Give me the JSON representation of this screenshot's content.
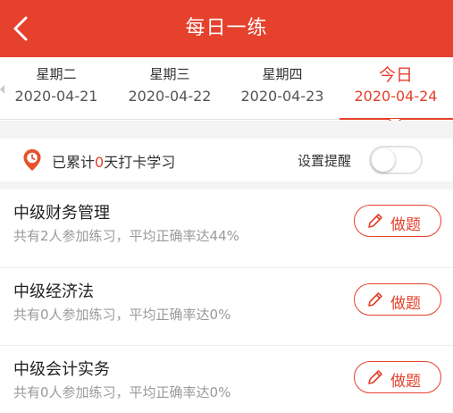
{
  "header": {
    "title": "每日一练",
    "back_icon": "chevron-left-icon",
    "background_color": "#e5412c"
  },
  "date_tabs": [
    {
      "weekday": "星期二",
      "date": "2020-04-21",
      "active": false
    },
    {
      "weekday": "星期三",
      "date": "2020-04-22",
      "active": false
    },
    {
      "weekday": "星期四",
      "date": "2020-04-23",
      "active": false
    },
    {
      "weekday": "今日",
      "date": "2020-04-24",
      "active": true
    }
  ],
  "checkin": {
    "icon": "location-clock-icon",
    "prefix": "已累计",
    "days": "0",
    "suffix": "天打卡学习",
    "reminder_label": "设置提醒",
    "reminder_on": false
  },
  "courses": [
    {
      "name": "中级财务管理",
      "stats": "共有2人参加练习，平均正确率达44%",
      "button_label": "做题"
    },
    {
      "name": "中级经济法",
      "stats": "共有0人参加练习，平均正确率达0%",
      "button_label": "做题"
    },
    {
      "name": "中级会计实务",
      "stats": "共有0人参加练习，平均正确率达0%",
      "button_label": "做题"
    }
  ],
  "colors": {
    "accent": "#e5412c",
    "secondary_text": "#9a9a9a"
  }
}
